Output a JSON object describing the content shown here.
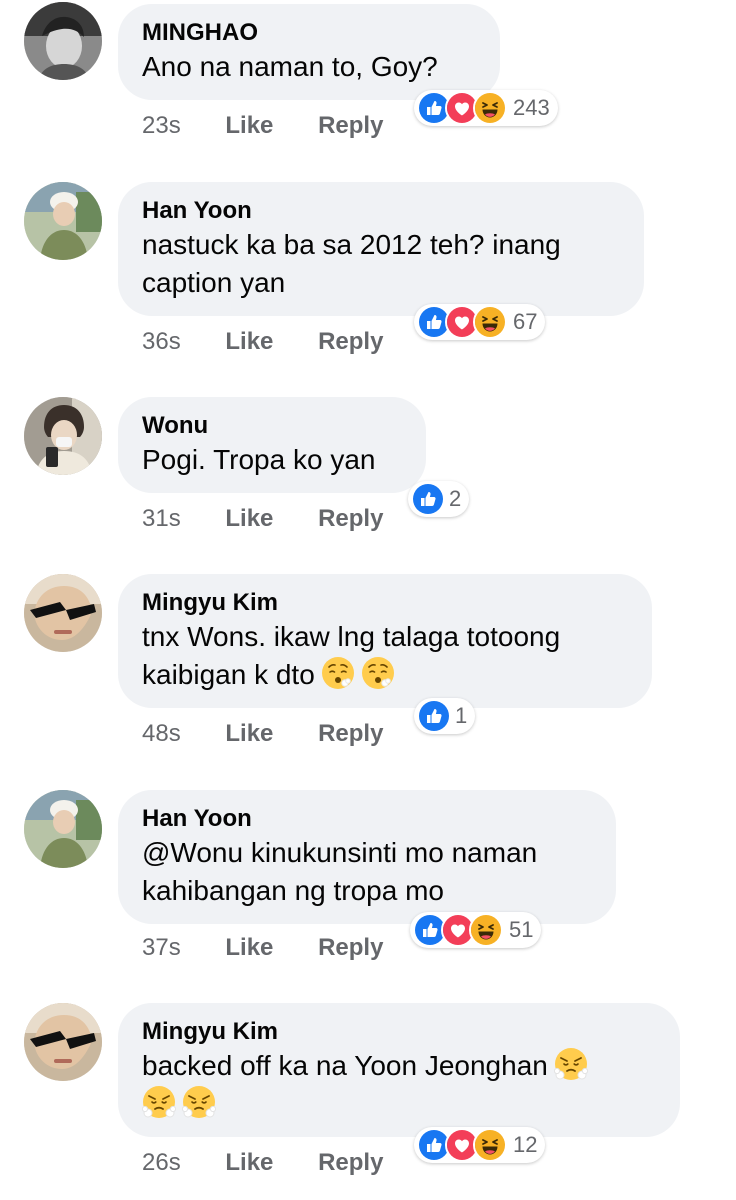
{
  "comments": [
    {
      "name": "MINGHAO",
      "text": "Ano na naman to, Goy?",
      "time": "23s",
      "like": "Like",
      "reply": "Reply",
      "reaction_count": "243"
    },
    {
      "name": "Han Yoon",
      "text": "nastuck ka ba sa 2012 teh? inang\ncaption yan",
      "time": "36s",
      "like": "Like",
      "reply": "Reply",
      "reaction_count": "67"
    },
    {
      "name": "Wonu",
      "text": "Pogi. Tropa ko yan",
      "time": "31s",
      "like": "Like",
      "reply": "Reply",
      "reaction_count": "2"
    },
    {
      "name": "Mingyu Kim",
      "text": "tnx Wons. ikaw lng talaga totoong\nkaibigan k dto",
      "time": "48s",
      "like": "Like",
      "reply": "Reply",
      "reaction_count": "1"
    },
    {
      "name": "Han Yoon",
      "text": "@Wonu kinukunsinti mo naman\nkahibangan ng tropa mo",
      "time": "37s",
      "like": "Like",
      "reply": "Reply",
      "reaction_count": "51"
    },
    {
      "name": "Mingyu Kim",
      "text": "backed off ka na Yoon Jeonghan",
      "time": "26s",
      "like": "Like",
      "reply": "Reply",
      "reaction_count": "12"
    }
  ],
  "icons": {
    "like": "like-reaction-icon",
    "love": "love-reaction-icon",
    "haha": "haha-reaction-icon",
    "sad": "pleading-emoji-icon",
    "angry": "huffing-emoji-icon"
  },
  "colors": {
    "like": "#1877f2",
    "love": "#f33e58",
    "haha": "#f7b125",
    "bubble": "#f0f2f5",
    "meta": "#65676b"
  }
}
